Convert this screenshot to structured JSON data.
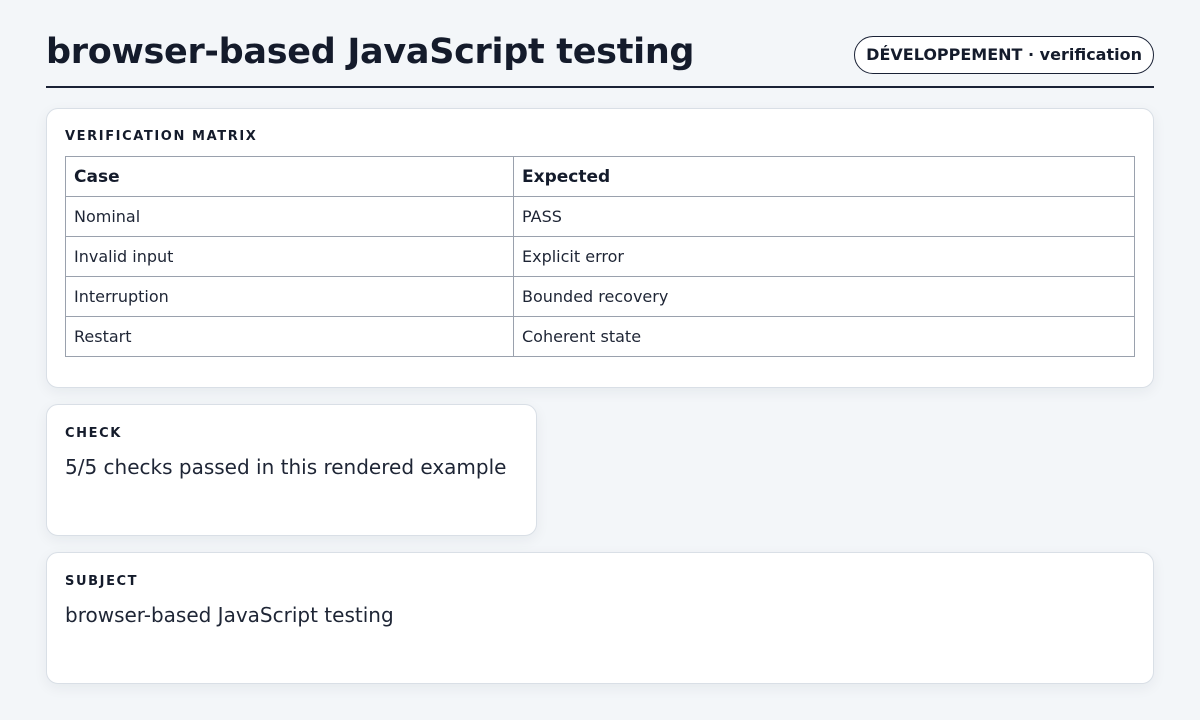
{
  "header": {
    "title": "browser-based JavaScript testing",
    "tag": "DÉVELOPPEMENT · verification"
  },
  "matrix": {
    "label": "VERIFICATION MATRIX",
    "columns": [
      "Case",
      "Expected"
    ],
    "rows": [
      [
        "Nominal",
        "PASS"
      ],
      [
        "Invalid input",
        "Explicit error"
      ],
      [
        "Interruption",
        "Bounded recovery"
      ],
      [
        "Restart",
        "Coherent state"
      ]
    ]
  },
  "check": {
    "label": "CHECK",
    "text": "5/5 checks passed in this rendered example"
  },
  "subject": {
    "label": "SUBJECT",
    "text": "browser-based JavaScript testing"
  }
}
